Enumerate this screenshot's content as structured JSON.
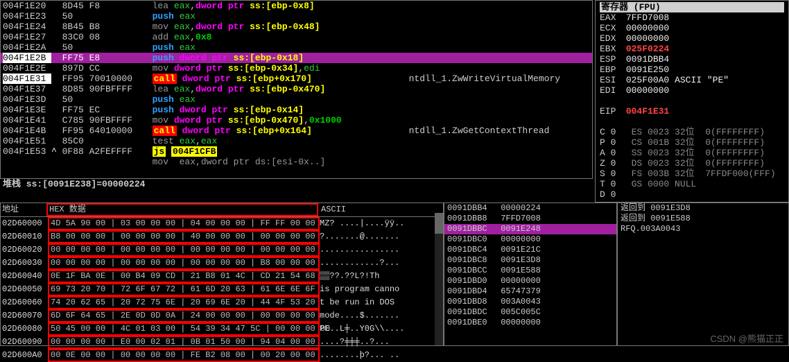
{
  "disasm": [
    {
      "addr": "004F1E20",
      "bytes": "8D45 F8",
      "mn": "lea",
      "mn_c": "mn-gray",
      "a1": "eax",
      "mem": "dword ptr ss:[ebp-0x8]"
    },
    {
      "addr": "004F1E23",
      "bytes": "50",
      "mn": "push",
      "mn_c": "mn-blue",
      "a1": "eax"
    },
    {
      "addr": "004F1E24",
      "bytes": "8B45 B8",
      "mn": "mov",
      "mn_c": "mn-gray",
      "a1": "eax",
      "mem": "dword ptr ss:[ebp-0x48]"
    },
    {
      "addr": "004F1E27",
      "bytes": "83C0 08",
      "mn": "add",
      "mn_c": "mn-gray",
      "a1": "eax",
      "num": "0x8"
    },
    {
      "addr": "004F1E2A",
      "bytes": "50",
      "mn": "push",
      "mn_c": "mn-blue",
      "a1": "eax"
    },
    {
      "addr": "004F1E2B",
      "bytes": "FF75 E8",
      "mn": "push",
      "mn_c": "mn-blue",
      "mem": "dword ptr ss:[ebp-0x18]",
      "row_hl": "hl-purple",
      "addr_hl": "hl-addr"
    },
    {
      "addr": "004F1E2E",
      "bytes": "897D CC",
      "mn": "mov",
      "mn_c": "mn-gray",
      "mem": "dword ptr ss:[ebp-0x34]",
      "reg2": "edi"
    },
    {
      "addr": "004F1E31",
      "bytes": "FF95 70010000",
      "mn": "call",
      "mn_c": "mn-red",
      "mem": "dword ptr ss:[ebp+0x170]",
      "cmt": "ntdll_1.ZwWriteVirtualMemory",
      "addr_hl": "hl-addr"
    },
    {
      "addr": "004F1E37",
      "bytes": "8D85 90FBFFFF",
      "mn": "lea",
      "mn_c": "mn-gray",
      "a1": "eax",
      "mem": "dword ptr ss:[ebp-0x470]"
    },
    {
      "addr": "004F1E3D",
      "bytes": "50",
      "mn": "push",
      "mn_c": "mn-blue",
      "a1": "eax"
    },
    {
      "addr": "004F1E3E",
      "bytes": "FF75 EC",
      "mn": "push",
      "mn_c": "mn-blue",
      "mem": "dword ptr ss:[ebp-0x14]"
    },
    {
      "addr": "004F1E41",
      "bytes": "C785 90FBFFFF",
      "mn": "mov",
      "mn_c": "mn-gray",
      "mem": "dword ptr ss:[ebp-0x470]",
      "num": "0x1000"
    },
    {
      "addr": "004F1E4B",
      "bytes": "FF95 64010000",
      "mn": "call",
      "mn_c": "mn-red",
      "mem": "dword ptr ss:[ebp+0x164]",
      "cmt": "ntdll_1.ZwGetContextThread"
    },
    {
      "addr": "004F1E51",
      "bytes": "85C0",
      "mn": "test",
      "mn_c": "mn-gray",
      "a1": "eax",
      "reg2": "eax"
    },
    {
      "addr": "004F1E53",
      "bytes": "0F88 A2FEFFFF",
      "mn": "js",
      "mn_c": "mn-ylw",
      "lbl": "004F1CFB",
      "prefix": "^"
    },
    {
      "addr": "",
      "bytes": "",
      "raw": "mov  eax,dword ptr ds:[esi-0x..]",
      "row_hl": ""
    }
  ],
  "stackline": "堆栈 ss:[0091E238]=00000224",
  "registers": {
    "title": "寄存器 (FPU)",
    "regs": [
      {
        "n": "EAX",
        "v": "7FFD7008"
      },
      {
        "n": "ECX",
        "v": "00000000"
      },
      {
        "n": "EDX",
        "v": "00000000"
      },
      {
        "n": "EBX",
        "v": "025F0224",
        "red": true
      },
      {
        "n": "ESP",
        "v": "0091DBB4"
      },
      {
        "n": "EBP",
        "v": "0091E250"
      },
      {
        "n": "ESI",
        "v": "025F00A0",
        "cmt": "ASCII \"PE\""
      },
      {
        "n": "EDI",
        "v": "00000000"
      }
    ],
    "eip": {
      "n": "EIP",
      "v": "004F1E31"
    },
    "flags": [
      {
        "f": "C",
        "b": "0",
        "seg": "ES",
        "segv": "0023",
        "d": "32位",
        "m": "0(FFFFFFFF)"
      },
      {
        "f": "P",
        "b": "0",
        "seg": "CS",
        "segv": "001B",
        "d": "32位",
        "m": "0(FFFFFFFF)"
      },
      {
        "f": "A",
        "b": "0",
        "seg": "SS",
        "segv": "0023",
        "d": "32位",
        "m": "0(FFFFFFFF)"
      },
      {
        "f": "Z",
        "b": "0",
        "seg": "DS",
        "segv": "0023",
        "d": "32位",
        "m": "0(FFFFFFFF)"
      },
      {
        "f": "S",
        "b": "0",
        "seg": "FS",
        "segv": "003B",
        "d": "32位",
        "m": "7FFDF000(FFF)"
      },
      {
        "f": "T",
        "b": "0",
        "seg": "GS",
        "segv": "0000",
        "d": "NULL",
        "m": ""
      },
      {
        "f": "D",
        "b": "0",
        "seg": "",
        "segv": "",
        "d": "",
        "m": ""
      }
    ]
  },
  "hex": {
    "hdr": {
      "addr": "地址",
      "hex": "HEX 数据",
      "ascii": "ASCII"
    },
    "rows": [
      {
        "a": "02D60000",
        "b": "4D 5A 90 00 | 03 00 00 00 | 04 00 00 00 | FF FF 00 00",
        "s": "MZ? ....|....ÿÿ.."
      },
      {
        "a": "02D60010",
        "b": "B8 00 00 00 | 00 00 00 00 | 40 00 00 00 | 00 00 00 00",
        "s": "?.......@......."
      },
      {
        "a": "02D60020",
        "b": "00 00 00 00 | 00 00 00 00 | 00 00 00 00 | 00 00 00 00",
        "s": "................"
      },
      {
        "a": "02D60030",
        "b": "00 00 00 00 | 00 00 00 00 | 00 00 00 00 | B8 00 00 00",
        "s": "............?..."
      },
      {
        "a": "02D60040",
        "b": "0E 1F BA 0E | 00 B4 09 CD | 21 B8 01 4C | CD 21 54 68",
        "s": "▒▒??.??L?!Th"
      },
      {
        "a": "02D60050",
        "b": "69 73 20 70 | 72 6F 67 72 | 61 6D 20 63 | 61 6E 6E 6F",
        "s": "is program canno"
      },
      {
        "a": "02D60060",
        "b": "74 20 62 65 | 20 72 75 6E | 20 69 6E 20 | 44 4F 53 20",
        "s": "t be run in DOS "
      },
      {
        "a": "02D60070",
        "b": "6D 6F 64 65 | 2E 0D 0D 0A | 24 00 00 00 | 00 00 00 00",
        "s": "mode....$......."
      },
      {
        "a": "02D60080",
        "b": "50 45 00 00 | 4C 01 03 00 | 54 39 34 47 5C | 00 00 00 00",
        "s": "PE..L╪..Y0G\\\\...."
      },
      {
        "a": "02D60090",
        "b": "00 00 00 00 | E0 00 02 01 | 0B 01 50 00 | 94 04 00 00",
        "s": "....?╪╪╪..?..."
      },
      {
        "a": "02D600A0",
        "b": "00 0E 00 00 | 00 00 00 00 | FE B2 08 00 | 00 20 00 00",
        "s": "........þ?... .."
      }
    ]
  },
  "stack": [
    {
      "a": "0091DBB4",
      "v": "00000224"
    },
    {
      "a": "0091DBB8",
      "v": "7FFD7008"
    },
    {
      "a": "0091DBBC",
      "v": "0091E248",
      "hl": true
    },
    {
      "a": "0091DBC0",
      "v": "00000000"
    },
    {
      "a": "0091DBC4",
      "v": "0091E21C"
    },
    {
      "a": "0091DBC8",
      "v": "0091E3D8",
      "c": "返回到 0091E3D8"
    },
    {
      "a": "0091DBCC",
      "v": "0091E588",
      "c": "返回到 0091E588"
    },
    {
      "a": "0091DBD0",
      "v": "00000000"
    },
    {
      "a": "0091DBD4",
      "v": "65747379"
    },
    {
      "a": "0091DBD8",
      "v": "003A0043",
      "c": "RFQ.003A0043"
    },
    {
      "a": "0091DBDC",
      "v": "005C005C"
    },
    {
      "a": "0091DBE0",
      "v": "00000000"
    }
  ],
  "watermark": "CSDN @熊猫正正"
}
